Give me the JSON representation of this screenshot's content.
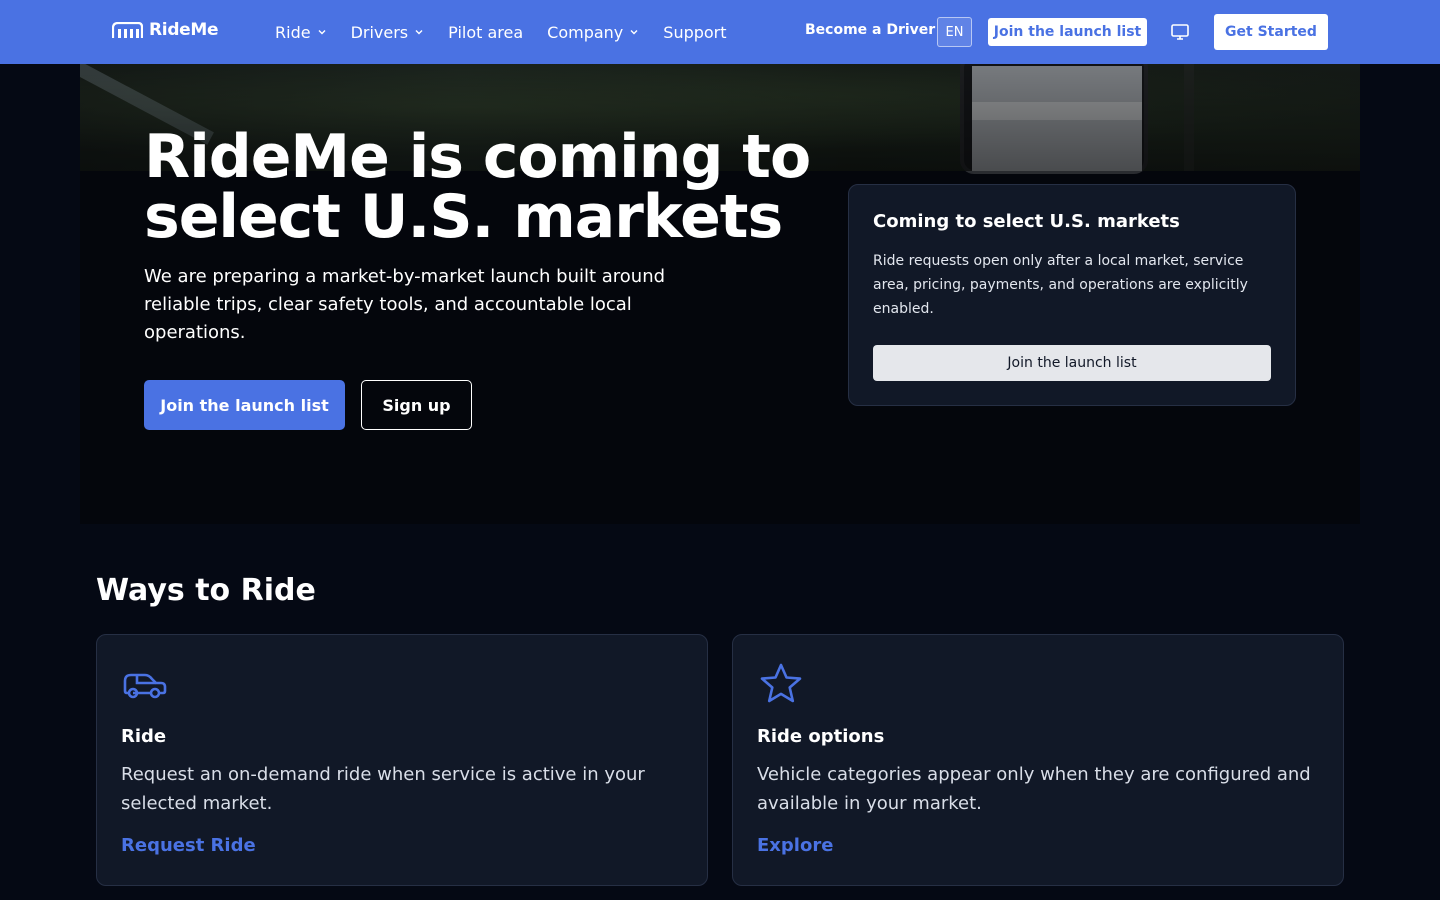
{
  "header": {
    "brand": "RideMe",
    "nav": [
      {
        "label": "Ride",
        "has_dropdown": true
      },
      {
        "label": "Drivers",
        "has_dropdown": true
      },
      {
        "label": "Pilot area",
        "has_dropdown": false
      },
      {
        "label": "Company",
        "has_dropdown": true
      },
      {
        "label": "Support",
        "has_dropdown": false
      }
    ],
    "become_driver": "Become a Driver",
    "language": "EN",
    "join_launch": "Join the launch list",
    "get_started": "Get Started",
    "monitor_icon": "monitor-icon"
  },
  "hero": {
    "title": "RideMe is coming to select U.S. markets",
    "subtitle": "We are preparing a market-by-market launch built around reliable trips, clear safety tools, and accountable local operations.",
    "primary_button": "Join the launch list",
    "secondary_button": "Sign up"
  },
  "info_card": {
    "title": "Coming to select U.S. markets",
    "text": "Ride requests open only after a local market, service area, pricing, payments, and operations are explicitly enabled.",
    "button": "Join the launch list"
  },
  "ways": {
    "title": "Ways to Ride",
    "cards": [
      {
        "icon": "car-icon",
        "title": "Ride",
        "text": "Request an on-demand ride when service is active in your selected market.",
        "link": "Request Ride"
      },
      {
        "icon": "star-icon",
        "title": "Ride options",
        "text": "Vehicle categories appear only when they are configured and available in your market.",
        "link": "Explore"
      }
    ]
  },
  "colors": {
    "brand": "#4a72e3",
    "background": "#050914",
    "card": "#111827"
  }
}
